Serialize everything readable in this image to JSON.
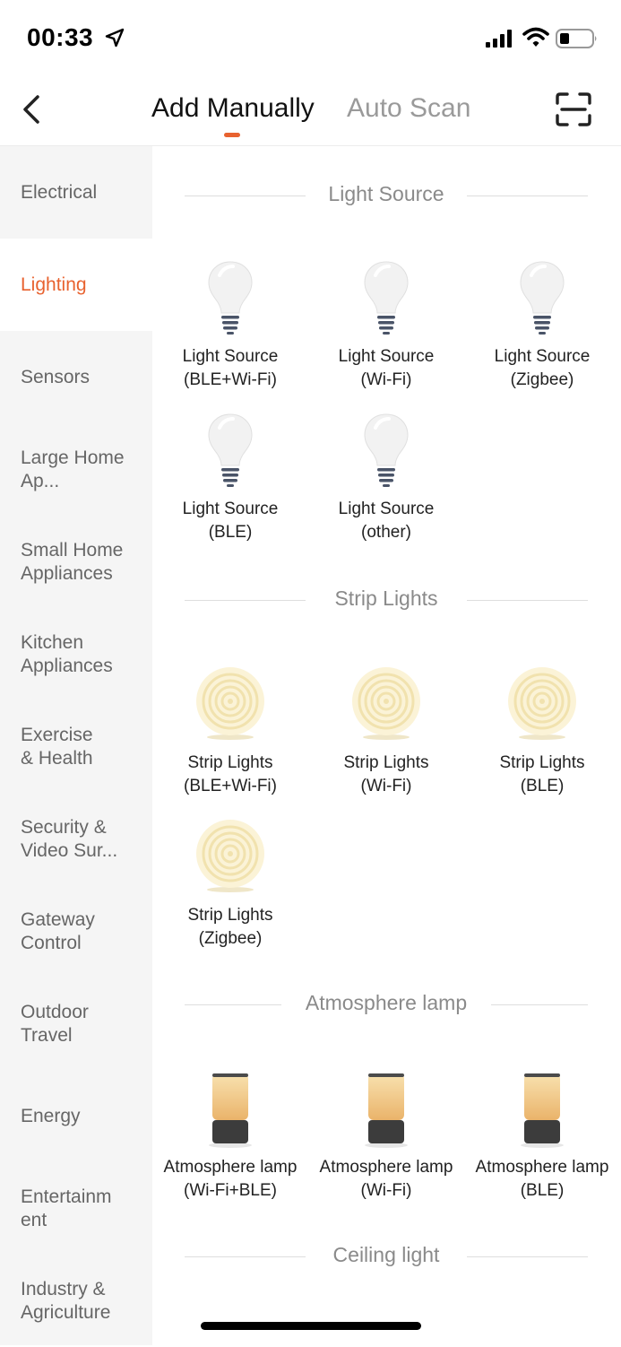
{
  "status_bar": {
    "time": "00:33"
  },
  "nav": {
    "tabs": [
      "Add Manually",
      "Auto Scan"
    ],
    "active_tab": "Add Manually",
    "accent_color": "#e8622f"
  },
  "sidebar": {
    "items": [
      {
        "label": "Electrical"
      },
      {
        "label": "Lighting"
      },
      {
        "label": "Sensors"
      },
      {
        "label": "Large Home Ap..."
      },
      {
        "label": "Small Home Appliances"
      },
      {
        "label": "Kitchen Appliances"
      },
      {
        "label": "Exercise & Health"
      },
      {
        "label": "Security & Video Sur..."
      },
      {
        "label": "Gateway Control"
      },
      {
        "label": "Outdoor Travel"
      },
      {
        "label": "Energy"
      },
      {
        "label": "Entertainm ent"
      },
      {
        "label": "Industry & Agriculture"
      }
    ],
    "active": "Lighting"
  },
  "sections": [
    {
      "title": "Light Source",
      "icon": "light-bulb-icon",
      "items": [
        {
          "line1": "Light Source",
          "line2": "(BLE+Wi-Fi)"
        },
        {
          "line1": "Light Source",
          "line2": "(Wi-Fi)"
        },
        {
          "line1": "Light Source",
          "line2": "(Zigbee)"
        },
        {
          "line1": "Light Source",
          "line2": "(BLE)"
        },
        {
          "line1": "Light Source",
          "line2": "(other)"
        }
      ]
    },
    {
      "title": "Strip Lights",
      "icon": "strip-light-icon",
      "items": [
        {
          "line1": "Strip Lights",
          "line2": "(BLE+Wi-Fi)"
        },
        {
          "line1": "Strip Lights",
          "line2": "(Wi-Fi)"
        },
        {
          "line1": "Strip Lights",
          "line2": "(BLE)"
        },
        {
          "line1": "Strip Lights",
          "line2": "(Zigbee)"
        }
      ]
    },
    {
      "title": "Atmosphere lamp",
      "icon": "atmosphere-lamp-icon",
      "items": [
        {
          "line1": "Atmosphere lamp",
          "line2": "(Wi-Fi+BLE)"
        },
        {
          "line1": "Atmosphere lamp",
          "line2": "(Wi-Fi)"
        },
        {
          "line1": "Atmosphere lamp",
          "line2": "(BLE)"
        }
      ]
    },
    {
      "title": "Ceiling light",
      "icon": "ceiling-light-icon",
      "items": []
    }
  ]
}
